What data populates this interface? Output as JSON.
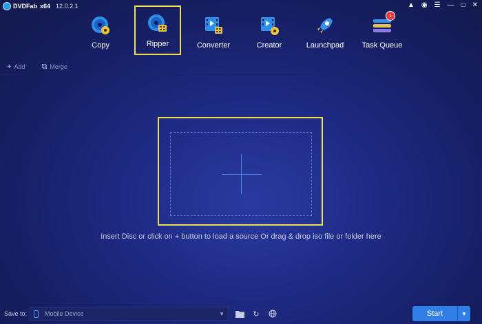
{
  "app": {
    "brand": "DVDFab",
    "arch": "x64",
    "version": "12.0.2.1"
  },
  "window_controls": [
    "shirt-icon",
    "wifi-icon",
    "menu-icon",
    "minimize-icon",
    "maximize-icon",
    "close-icon"
  ],
  "toolbar": {
    "items": [
      {
        "label": "Copy",
        "icon": "disc-copy-icon"
      },
      {
        "label": "Ripper",
        "icon": "disc-ripper-icon",
        "active": true
      },
      {
        "label": "Converter",
        "icon": "film-converter-icon"
      },
      {
        "label": "Creator",
        "icon": "film-creator-icon"
      },
      {
        "label": "Launchpad",
        "icon": "rocket-icon"
      },
      {
        "label": "Task Queue",
        "icon": "stack-icon",
        "badge": "1"
      }
    ]
  },
  "actions": {
    "add": "Add",
    "merge": "Merge"
  },
  "main": {
    "hint": "Insert Disc or click on + button to load a source Or drag & drop iso file or folder here"
  },
  "bottom": {
    "save_to_label": "Save to:",
    "save_to_value": "Mobile Device",
    "start_label": "Start"
  },
  "colors": {
    "accent": "#2f7fe6",
    "highlight": "#f0e04a",
    "badge": "#e8383f"
  }
}
